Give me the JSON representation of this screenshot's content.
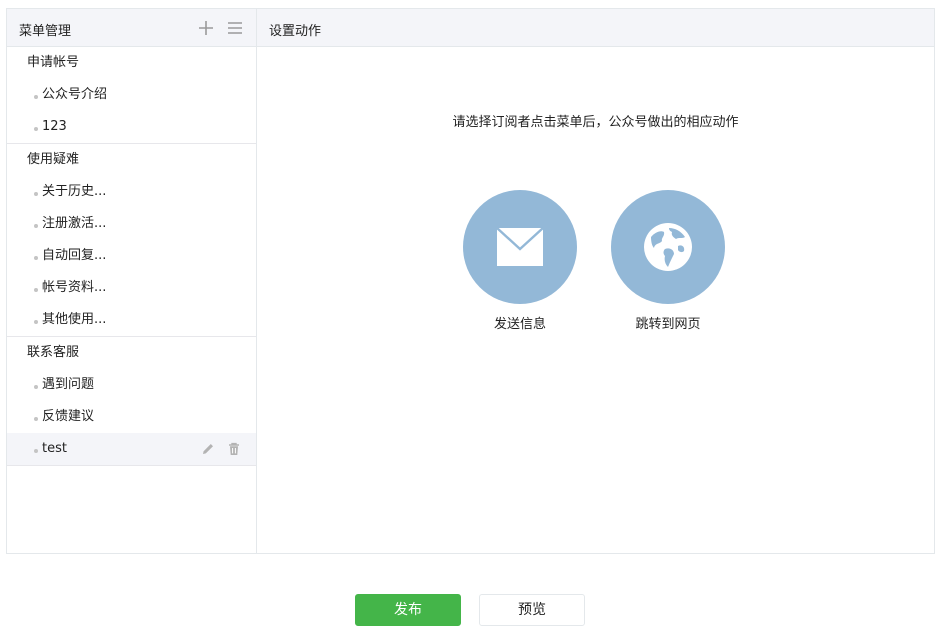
{
  "menu_panel": {
    "title": "菜单管理",
    "add_icon": "plus-icon",
    "sort_icon": "list-icon",
    "groups": [
      {
        "label": "申请帐号",
        "items": [
          "公众号介绍",
          "123"
        ]
      },
      {
        "label": "使用疑难",
        "items": [
          "关于历史...",
          "注册激活...",
          "自动回复...",
          "帐号资料...",
          "其他使用..."
        ]
      },
      {
        "label": "联系客服",
        "items": [
          "遇到问题",
          "反馈建议",
          "test"
        ]
      }
    ],
    "selected_item": "test",
    "row_icons": {
      "edit": "pencil-icon",
      "delete": "trash-icon"
    }
  },
  "action_panel": {
    "title": "设置动作",
    "prompt": "请选择订阅者点击菜单后，公众号做出的相应动作",
    "actions": [
      {
        "label": "发送信息",
        "icon": "envelope-icon"
      },
      {
        "label": "跳转到网页",
        "icon": "globe-icon"
      }
    ]
  },
  "footer": {
    "publish_label": "发布",
    "preview_label": "预览"
  },
  "colors": {
    "accent_green": "#44b549",
    "circle_blue": "#93b8d7",
    "header_bg": "#f4f5f9",
    "border": "#e4e8eb"
  }
}
